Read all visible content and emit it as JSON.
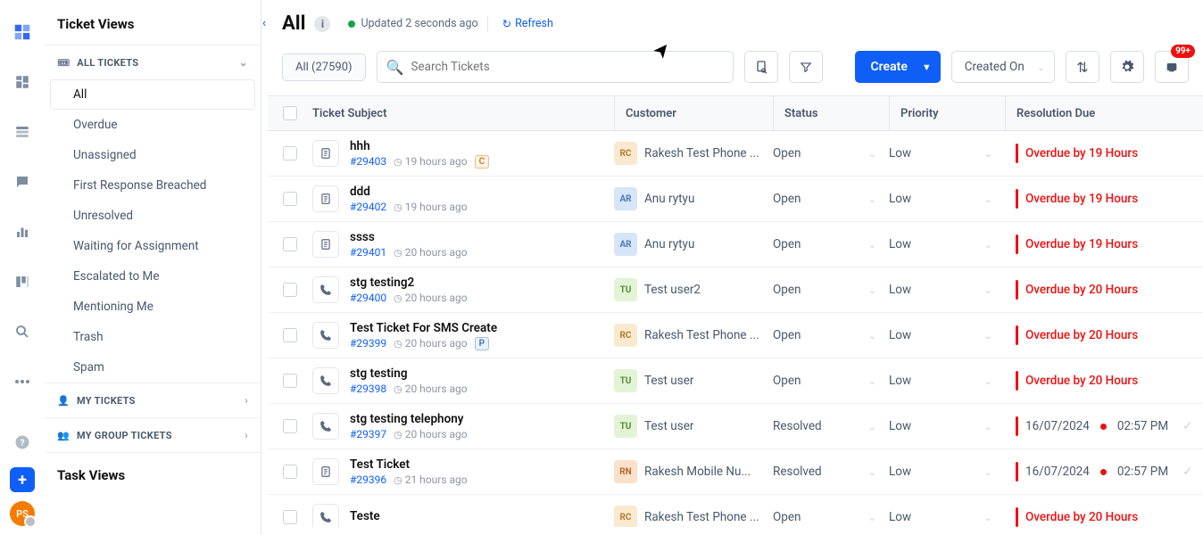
{
  "rail": {
    "avatar_initials": "PS"
  },
  "sidebar": {
    "title": "Ticket Views",
    "sections": [
      {
        "label": "ALL TICKETS",
        "expanded": true
      },
      {
        "label": "MY TICKETS",
        "expanded": false
      },
      {
        "label": "MY GROUP TICKETS",
        "expanded": false
      }
    ],
    "items": [
      {
        "label": "All",
        "active": true
      },
      {
        "label": "Overdue"
      },
      {
        "label": "Unassigned"
      },
      {
        "label": "First Response Breached"
      },
      {
        "label": "Unresolved"
      },
      {
        "label": "Waiting for Assignment"
      },
      {
        "label": "Escalated to Me"
      },
      {
        "label": "Mentioning Me"
      },
      {
        "label": "Trash"
      },
      {
        "label": "Spam"
      }
    ],
    "task_title": "Task Views"
  },
  "header": {
    "title": "All",
    "updated": "Updated 2 seconds ago",
    "refresh": "Refresh"
  },
  "toolbar": {
    "chip": "All (27590)",
    "search_placeholder": "Search Tickets",
    "create": "Create",
    "sort_label": "Created On",
    "noti_badge": "99+"
  },
  "columns": {
    "subject": "Ticket Subject",
    "customer": "Customer",
    "status": "Status",
    "priority": "Priority",
    "resolution": "Resolution Due"
  },
  "rows": [
    {
      "icon": "doc",
      "title": "hhh",
      "id": "#29403",
      "time": "19 hours ago",
      "tag": "C",
      "cust_i": "RC",
      "cust_cls": "av-rc",
      "cust": "Rakesh Test Phone ...",
      "status": "Open",
      "prio": "Low",
      "res": {
        "type": "over",
        "text": "Overdue by 19 Hours"
      }
    },
    {
      "icon": "doc",
      "title": "ddd",
      "id": "#29402",
      "time": "19 hours ago",
      "cust_i": "AR",
      "cust_cls": "av-ar",
      "cust": "Anu rytyu",
      "status": "Open",
      "prio": "Low",
      "res": {
        "type": "over",
        "text": "Overdue by 19 Hours"
      }
    },
    {
      "icon": "doc",
      "title": "ssss",
      "id": "#29401",
      "time": "20 hours ago",
      "cust_i": "AR",
      "cust_cls": "av-ar",
      "cust": "Anu rytyu",
      "status": "Open",
      "prio": "Low",
      "res": {
        "type": "over",
        "text": "Overdue by 19 Hours"
      }
    },
    {
      "icon": "phone",
      "title": "stg testing2",
      "id": "#29400",
      "time": "20 hours ago",
      "cust_i": "TU",
      "cust_cls": "av-tu",
      "cust": "Test user2",
      "status": "Open",
      "prio": "Low",
      "res": {
        "type": "over",
        "text": "Overdue by 20 Hours"
      }
    },
    {
      "icon": "phone",
      "title": "Test Ticket For SMS Create",
      "id": "#29399",
      "time": "20 hours ago",
      "tag": "P",
      "cust_i": "RC",
      "cust_cls": "av-rc",
      "cust": "Rakesh Test Phone ...",
      "status": "Open",
      "prio": "Low",
      "res": {
        "type": "over",
        "text": "Overdue by 20 Hours"
      }
    },
    {
      "icon": "phone",
      "title": "stg testing",
      "id": "#29398",
      "time": "20 hours ago",
      "cust_i": "TU",
      "cust_cls": "av-tu",
      "cust": "Test user",
      "status": "Open",
      "prio": "Low",
      "res": {
        "type": "over",
        "text": "Overdue by 20 Hours"
      }
    },
    {
      "icon": "phone",
      "title": "stg testing telephony",
      "id": "#29397",
      "time": "20 hours ago",
      "cust_i": "TU",
      "cust_cls": "av-tu",
      "cust": "Test user",
      "status": "Resolved",
      "prio": "Low",
      "res": {
        "type": "date",
        "date": "16/07/2024",
        "time": "02:57 PM"
      }
    },
    {
      "icon": "doc",
      "title": "Test Ticket",
      "id": "#29396",
      "time": "21 hours ago",
      "cust_i": "RN",
      "cust_cls": "av-rn",
      "cust": "Rakesh Mobile Nu...",
      "status": "Resolved",
      "prio": "Low",
      "res": {
        "type": "date",
        "date": "16/07/2024",
        "time": "02:57 PM"
      }
    },
    {
      "icon": "phone",
      "title": "Teste",
      "id": "",
      "time": "",
      "cust_i": "RC",
      "cust_cls": "av-rc",
      "cust": "Rakesh Test Phone ...",
      "status": "Open",
      "prio": "Low",
      "res": {
        "type": "over",
        "text": "Overdue by 20 Hours"
      }
    }
  ]
}
